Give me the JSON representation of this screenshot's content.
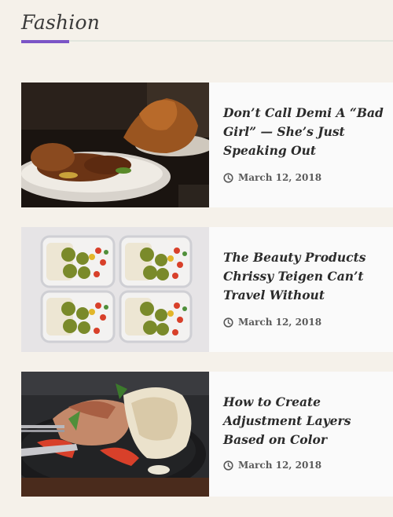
{
  "section": {
    "title": "Fashion",
    "accent_color": "#7b55c6"
  },
  "articles": [
    {
      "title": "Don’t Call Demi A “Bad Girl” — She’s Just Speaking Out",
      "date": "March 12, 2018",
      "image": "roast-chicken-plate"
    },
    {
      "title": "The Beauty Products Chrissy Teigen Can’t Travel Without",
      "date": "March 12, 2018",
      "image": "meal-prep-containers"
    },
    {
      "title": "How to Create Adjustment Layers Based on Color",
      "date": "March 12, 2018",
      "image": "fajita-wrap-skillet"
    }
  ]
}
